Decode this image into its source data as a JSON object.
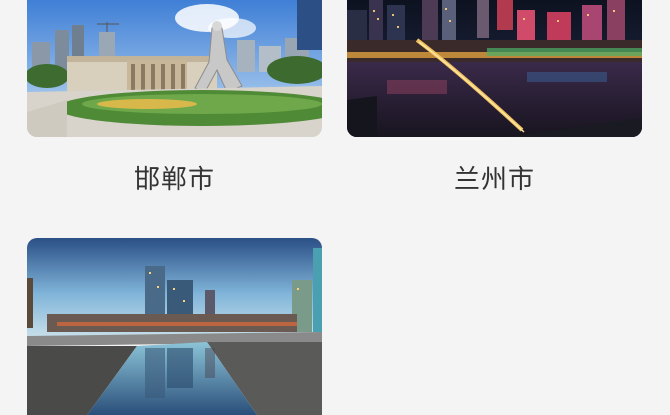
{
  "cities": [
    {
      "name": "邯郸市"
    },
    {
      "name": "兰州市"
    },
    {
      "name": ""
    }
  ]
}
